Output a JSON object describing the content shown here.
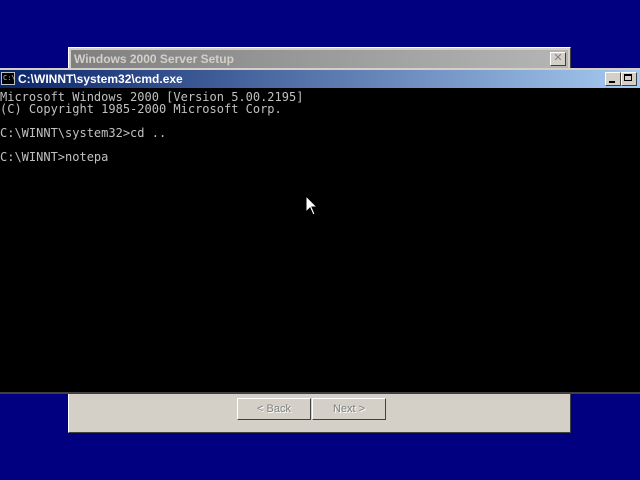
{
  "setup_window": {
    "title": "Windows 2000 Server Setup",
    "back_label": "< Back",
    "next_label": "Next >"
  },
  "cmd_window": {
    "title": "C:\\WINNT\\system32\\cmd.exe",
    "icon": "C:\\",
    "lines": [
      "Microsoft Windows 2000 [Version 5.00.2195]",
      "(C) Copyright 1985-2000 Microsoft Corp.",
      "",
      "C:\\WINNT\\system32>cd ..",
      "",
      "C:\\WINNT>notepa"
    ]
  },
  "icons": {
    "close": "close-icon",
    "minimize": "minimize-icon",
    "maximize": "maximize-icon",
    "pointer": "mouse-pointer-icon"
  }
}
